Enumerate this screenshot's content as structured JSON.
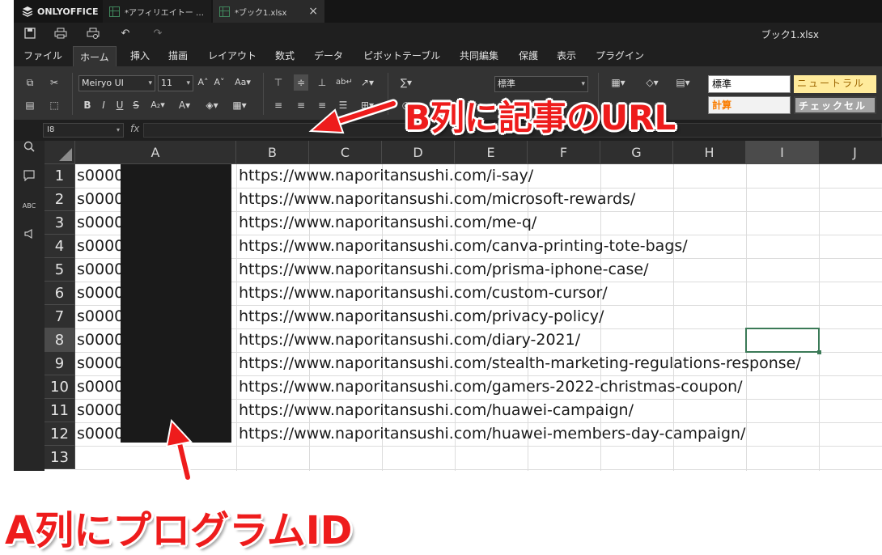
{
  "app": {
    "brand": "ONLYOFFICE",
    "tabs": [
      {
        "label": "*アフィリエイトー …"
      },
      {
        "label": "*ブック1.xlsx"
      }
    ],
    "document_title": "ブック1.xlsx"
  },
  "menu": {
    "items": [
      "ファイル",
      "ホーム",
      "挿入",
      "描画",
      "レイアウト",
      "数式",
      "データ",
      "ピボットテーブル",
      "共同編集",
      "保護",
      "表示",
      "プラグイン"
    ],
    "active": "ホーム"
  },
  "toolbar": {
    "font_name": "Meiryo UI",
    "font_size": "11",
    "number_format": "標準",
    "styles": [
      "標準",
      "ニュートラル",
      "計算",
      "チェックセル"
    ]
  },
  "formula_bar": {
    "cell_ref": "I8",
    "fx_label": "fx",
    "value": ""
  },
  "sheet": {
    "columns": [
      "A",
      "B",
      "C",
      "D",
      "E",
      "F",
      "G",
      "H",
      "I",
      "J"
    ],
    "selected_column": "I",
    "selected_row": "8",
    "rows": [
      {
        "num": "1",
        "a": "s0000",
        "b": "https://www.naporitansushi.com/i-say/"
      },
      {
        "num": "2",
        "a": "s0000",
        "b": "https://www.naporitansushi.com/microsoft-rewards/"
      },
      {
        "num": "3",
        "a": "s0000",
        "b": "https://www.naporitansushi.com/me-q/"
      },
      {
        "num": "4",
        "a": "s0000",
        "b": "https://www.naporitansushi.com/canva-printing-tote-bags/"
      },
      {
        "num": "5",
        "a": "s0000",
        "b": "https://www.naporitansushi.com/prisma-iphone-case/"
      },
      {
        "num": "6",
        "a": "s0000",
        "b": "https://www.naporitansushi.com/custom-cursor/"
      },
      {
        "num": "7",
        "a": "s0000",
        "b": "https://www.naporitansushi.com/privacy-policy/"
      },
      {
        "num": "8",
        "a": "s0000",
        "b": "https://www.naporitansushi.com/diary-2021/"
      },
      {
        "num": "9",
        "a": "s0000",
        "b": "https://www.naporitansushi.com/stealth-marketing-regulations-response/"
      },
      {
        "num": "10",
        "a": "s0000",
        "b": "https://www.naporitansushi.com/gamers-2022-christmas-coupon/"
      },
      {
        "num": "11",
        "a": "s0000",
        "b": "https://www.naporitansushi.com/huawei-campaign/"
      },
      {
        "num": "12",
        "a": "s0000",
        "b": "https://www.naporitansushi.com/huawei-members-day-campaign/"
      },
      {
        "num": "13",
        "a": "",
        "b": ""
      }
    ]
  },
  "annotations": {
    "column_b": "B列に記事のURL",
    "column_a": "A列にプログラムID"
  },
  "colors": {
    "arrow_red": "#ee1c1c",
    "selection_green": "#3b7a57",
    "sheet_icon_green": "#40865c"
  }
}
